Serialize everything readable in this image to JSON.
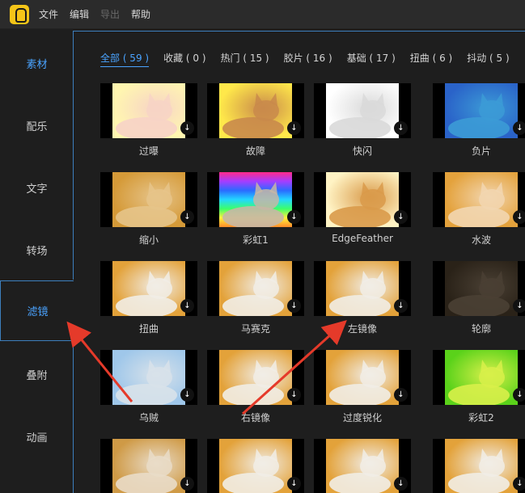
{
  "menubar": {
    "items": [
      "文件",
      "编辑",
      "导出",
      "帮助"
    ]
  },
  "sidebar": {
    "items": [
      {
        "label": "素材"
      },
      {
        "label": "配乐"
      },
      {
        "label": "文字"
      },
      {
        "label": "转场"
      },
      {
        "label": "滤镜"
      },
      {
        "label": "叠附"
      },
      {
        "label": "动画"
      }
    ]
  },
  "tabs": [
    {
      "label": "全部 ( 59 )"
    },
    {
      "label": "收藏 ( 0 )"
    },
    {
      "label": "热门 ( 15 )"
    },
    {
      "label": "胶片 ( 16 )"
    },
    {
      "label": "基础 ( 17 )"
    },
    {
      "label": "扭曲 ( 6 )"
    },
    {
      "label": "抖动 ( 5 )"
    }
  ],
  "filters": [
    {
      "label": "过曝",
      "bg": "#fff6b0",
      "tone": "#f7d3c6"
    },
    {
      "label": "故障",
      "bg": "#ffe84a",
      "tone": "#c98a4b"
    },
    {
      "label": "快闪",
      "bg": "#ffffff",
      "tone": "#d9d9d9"
    },
    {
      "label": "负片",
      "bg": "#2a63c9",
      "tone": "#3c9bd6"
    },
    {
      "label": "缩小",
      "bg": "#d59a38",
      "tone": "#e6c48a"
    },
    {
      "label": "彩虹1",
      "bg": "rainbow",
      "tone": "#c7b7a6"
    },
    {
      "label": "EdgeFeather",
      "bg": "#fff3c4",
      "tone": "#d99a4a"
    },
    {
      "label": "水波",
      "bg": "#e4a23c",
      "tone": "#f2d6b0"
    },
    {
      "label": "扭曲",
      "bg": "#e3a23a",
      "tone": "#f1ede6"
    },
    {
      "label": "马赛克",
      "bg": "#e3a23a",
      "tone": "#f1ede6"
    },
    {
      "label": "左镜像",
      "bg": "#e3a23a",
      "tone": "#f1ede6"
    },
    {
      "label": "轮廓",
      "bg": "#2a2218",
      "tone": "#4a4034"
    },
    {
      "label": "乌贼",
      "bg": "#9fc7ea",
      "tone": "#d8e2ea"
    },
    {
      "label": "右镜像",
      "bg": "#e3a23a",
      "tone": "#f1ede6"
    },
    {
      "label": "过度锐化",
      "bg": "#e3a23a",
      "tone": "#f1ede6"
    },
    {
      "label": "彩虹2",
      "bg": "#5ad21a",
      "tone": "#d8f04a"
    },
    {
      "label": "",
      "bg": "#cf9a46",
      "tone": "#e9dcc8"
    },
    {
      "label": "",
      "bg": "#e3a23a",
      "tone": "#f1ede6"
    },
    {
      "label": "",
      "bg": "#e3a23a",
      "tone": "#f1ede6"
    },
    {
      "label": "",
      "bg": "#e3a23a",
      "tone": "#f1ede6"
    }
  ],
  "download_icon": "↓",
  "colors": {
    "accent": "#4aa3ff",
    "arrow": "#e53a2a"
  }
}
